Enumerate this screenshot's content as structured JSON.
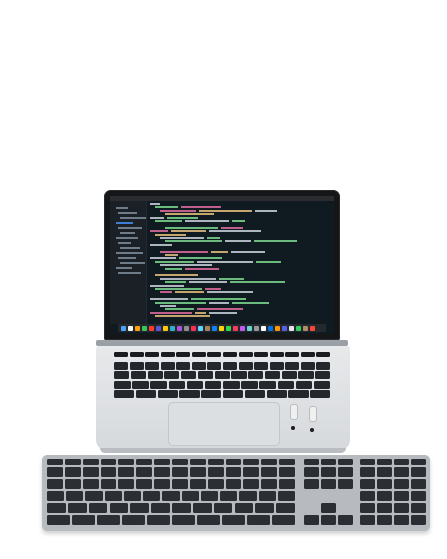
{
  "scene": {
    "objects": [
      "laptop",
      "laptop-screen-code-editor",
      "laptop-keyboard",
      "trackpad",
      "earbuds",
      "external-keyboard"
    ],
    "colors": {
      "background": "#ffffff",
      "screen_bg": "#0f1a21",
      "code_green": "#7bd88f",
      "code_pink": "#e06c9f",
      "code_yellow": "#e5c07b",
      "code_white": "#c9d1d9",
      "key_dark": "#2b2f33",
      "aluminum": "#d6d9dc"
    }
  }
}
